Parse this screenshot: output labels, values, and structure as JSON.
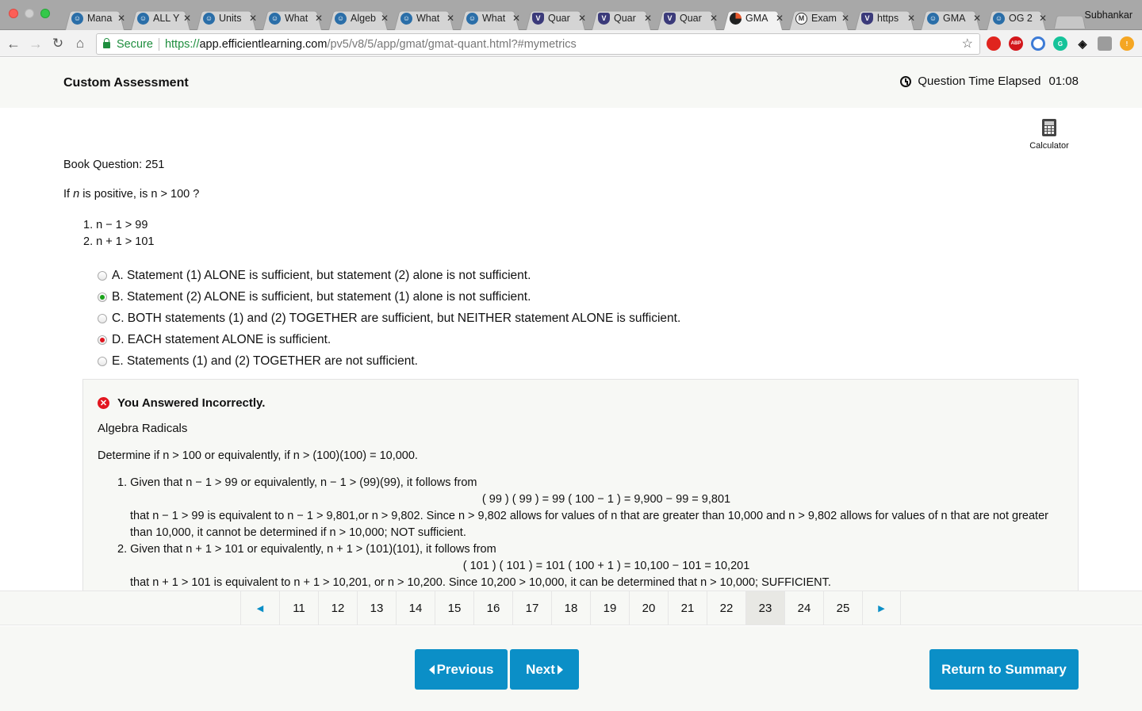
{
  "browser": {
    "tabs": [
      {
        "title": "Mana",
        "icon": "efficientlearning-favicon",
        "active": false
      },
      {
        "title": "ALL Y",
        "icon": "efficientlearning-favicon",
        "active": false
      },
      {
        "title": "Units",
        "icon": "efficientlearning-favicon",
        "active": false
      },
      {
        "title": "What",
        "icon": "efficientlearning-favicon",
        "active": false
      },
      {
        "title": "Algeb",
        "icon": "efficientlearning-favicon",
        "active": false
      },
      {
        "title": "What",
        "icon": "efficientlearning-favicon",
        "active": false
      },
      {
        "title": "What",
        "icon": "efficientlearning-favicon",
        "active": false
      },
      {
        "title": "Quar",
        "icon": "v-shield-favicon",
        "active": false
      },
      {
        "title": "Quar",
        "icon": "v-shield-favicon",
        "active": false
      },
      {
        "title": "Quar",
        "icon": "v-shield-favicon",
        "active": false
      },
      {
        "title": "GMA",
        "icon": "pie-favicon",
        "active": true
      },
      {
        "title": "Exam",
        "icon": "m-circle-favicon",
        "active": false
      },
      {
        "title": "https",
        "icon": "v-shield-favicon",
        "active": false
      },
      {
        "title": "GMA",
        "icon": "efficientlearning-favicon",
        "active": false
      },
      {
        "title": "OG 2",
        "icon": "efficientlearning-favicon",
        "active": false
      }
    ],
    "profile_name": "Subhankar",
    "secure_label": "Secure",
    "url_scheme": "https://",
    "url_host": "app.efficientlearning.com",
    "url_path": "/pv5/v8/5/app/gmat/gmat-quant.html?#mymetrics",
    "extensions": [
      "opera-stop-icon",
      "adblock-plus-icon",
      "block-icon",
      "grammarly-icon",
      "diamond-ext-icon",
      "gray-ext-icon",
      "warning-ext-icon"
    ],
    "ext_labels": [
      "",
      "ABP",
      "",
      "G",
      "◈",
      "",
      "!"
    ]
  },
  "header": {
    "title": "Custom Assessment",
    "timer_label": "Question Time Elapsed",
    "timer_value": "01:08"
  },
  "calculator_label": "Calculator",
  "question": {
    "label": "Book Question: 251",
    "text_pre": "If ",
    "text_var": "n",
    "text_post": " is positive, is n > 100 ?",
    "statements": [
      "1. n − 1 > 99",
      "2. n + 1 > 101"
    ]
  },
  "choices": [
    {
      "text": "A. Statement (1) ALONE is sufficient, but statement (2) alone is not sufficient.",
      "state": "none"
    },
    {
      "text": "B. Statement (2) ALONE is sufficient, but statement (1) alone is not sufficient.",
      "state": "correct"
    },
    {
      "text": "C. BOTH statements (1) and (2) TOGETHER are sufficient, but NEITHER statement ALONE is sufficient.",
      "state": "none"
    },
    {
      "text": "D. EACH statement ALONE is sufficient.",
      "state": "selected-wrong"
    },
    {
      "text": "E. Statements (1) and (2) TOGETHER are not sufficient.",
      "state": "none"
    }
  ],
  "explanation": {
    "result": "You Answered Incorrectly.",
    "topic": "Algebra Radicals",
    "determine": "Determine if n > 100 or equivalently, if n > (100)(100) = 10,000.",
    "steps": [
      {
        "intro": "1. Given that n − 1 > 99 or equivalently, n − 1 > (99)(99), it follows from",
        "equation": "( 99 ) ( 99 ) = 99 ( 100 − 1 ) = 9,900 − 99 = 9,801",
        "conclusion": "that n − 1 > 99 is equivalent to n − 1 > 9,801,or n > 9,802. Since n > 9,802 allows for values of n that are greater than 10,000 and n > 9,802 allows for values of n that are not greater than 10,000, it cannot be determined if n > 10,000; NOT sufficient."
      },
      {
        "intro": "2. Given that n + 1 > 101 or equivalently, n + 1 > (101)(101), it follows from",
        "equation": "( 101 ) ( 101 ) = 101 ( 100 + 1 ) = 10,100 − 101 = 10,201",
        "conclusion": "that n + 1 > 101 is equivalent to n + 1 > 10,201, or n > 10,200. Since 10,200 > 10,000, it can be determined that n > 10,000; SUFFICIENT."
      }
    ]
  },
  "pagination": {
    "pages": [
      "11",
      "12",
      "13",
      "14",
      "15",
      "16",
      "17",
      "18",
      "19",
      "20",
      "21",
      "22",
      "23",
      "24",
      "25"
    ],
    "current": "23"
  },
  "footer": {
    "previous_label": "Previous",
    "next_label": "Next",
    "summary_label": "Return to Summary"
  },
  "colors": {
    "accent": "#0b8fc7",
    "correct": "#1aa31a",
    "incorrect": "#e2161f"
  }
}
